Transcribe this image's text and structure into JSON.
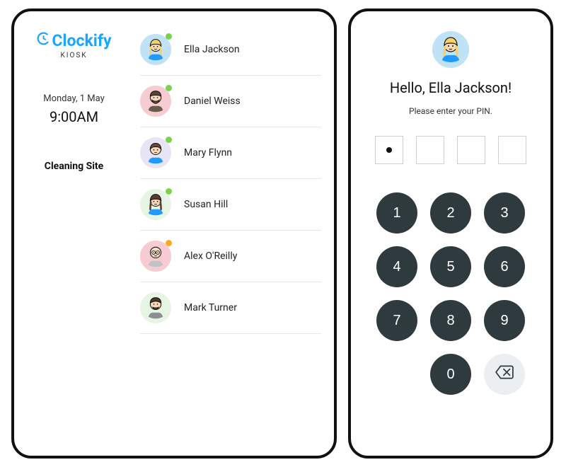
{
  "brand": {
    "name": "Clockify",
    "subtitle": "KIOSK"
  },
  "dateblock": {
    "date": "Monday, 1 May",
    "time": "9:00AM"
  },
  "site": "Cleaning Site",
  "employees": [
    {
      "name": "Ella Jackson",
      "bg": "#bfe2f7",
      "status": "green"
    },
    {
      "name": "Daniel Weiss",
      "bg": "#f6cbd1",
      "status": "green"
    },
    {
      "name": "Mary Flynn",
      "bg": "#e6e4f5",
      "status": "green"
    },
    {
      "name": "Susan Hill",
      "bg": "#e6f5e4",
      "status": "green"
    },
    {
      "name": "Alex O'Reilly",
      "bg": "#f6cbd1",
      "status": "orange"
    },
    {
      "name": "Mark Turner",
      "bg": "#e6f5e4",
      "status": "none"
    }
  ],
  "pin_screen": {
    "greeting": "Hello, Ella Jackson!",
    "prompt": "Please enter your PIN.",
    "filled_digits": 1,
    "keypad": [
      "1",
      "2",
      "3",
      "4",
      "5",
      "6",
      "7",
      "8",
      "9",
      "0"
    ]
  }
}
